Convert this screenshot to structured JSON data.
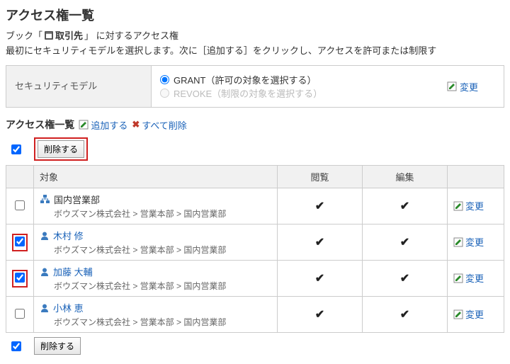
{
  "page": {
    "title": "アクセス権一覧",
    "book_pre": "ブック「",
    "book_name": "取引先",
    "book_post": "」 に対するアクセス権",
    "description": "最初にセキュリティモデルを選択します。次に［追加する］をクリックし、アクセスを許可または制限す"
  },
  "security_model": {
    "label": "セキュリティモデル",
    "grant_label": "GRANT（許可の対象を選択する）",
    "revoke_label": "REVOKE（制限の対象を選択する）",
    "grant_selected": true,
    "change_label": "変更"
  },
  "list": {
    "heading": "アクセス権一覧",
    "add_label": "追加する",
    "delete_all_label": "すべて削除",
    "bulk_delete_label": "削除する",
    "columns": {
      "target": "対象",
      "view": "閲覧",
      "edit": "編集"
    },
    "change_label": "変更",
    "rows": [
      {
        "type": "org",
        "checked": false,
        "name": "国内営業部",
        "breadcrumb": "ボウズマン株式会社 > 営業本部 > 国内営業部",
        "view": true,
        "edit": true,
        "highlighted": false,
        "link": false
      },
      {
        "type": "user",
        "checked": true,
        "name": "木村 修",
        "breadcrumb": "ボウズマン株式会社 > 営業本部 > 国内営業部",
        "view": true,
        "edit": true,
        "highlighted": true,
        "link": true
      },
      {
        "type": "user",
        "checked": true,
        "name": "加藤 大輔",
        "breadcrumb": "ボウズマン株式会社 > 営業本部 > 国内営業部",
        "view": true,
        "edit": true,
        "highlighted": true,
        "link": true
      },
      {
        "type": "user",
        "checked": false,
        "name": "小林 恵",
        "breadcrumb": "ボウズマン株式会社 > 営業本部 > 国内営業部",
        "view": true,
        "edit": true,
        "highlighted": false,
        "link": true
      }
    ],
    "header_checked": true,
    "footer_checked": true
  }
}
